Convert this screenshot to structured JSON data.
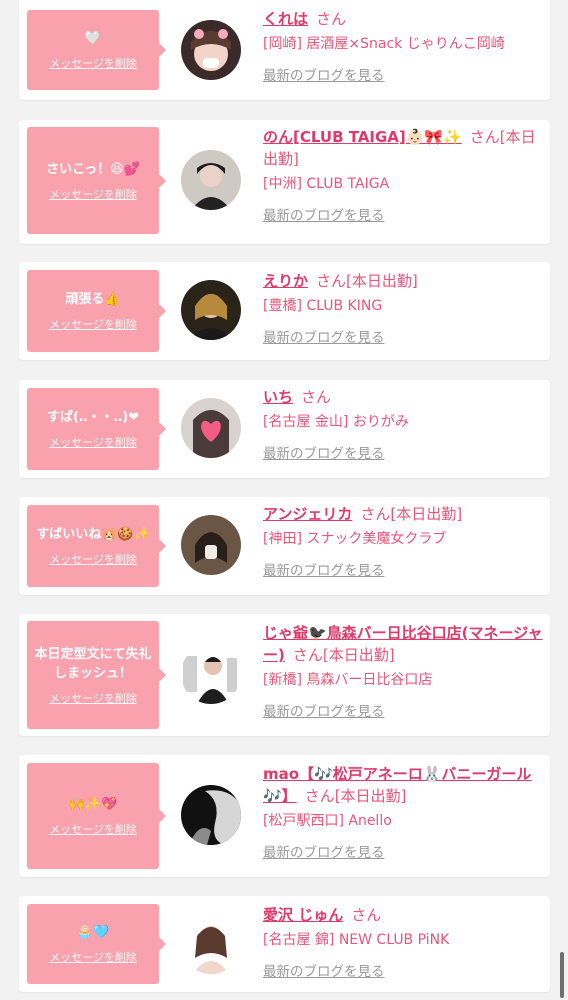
{
  "items": [
    {
      "message": "🤍",
      "delete_label": "メッセージを削除",
      "name": "くれは",
      "san": "さん",
      "shop": "[岡崎] 居酒屋×Snack じゃりんこ岡崎",
      "blog_label": "最新のブログを見る",
      "avatar": "avatar-photo-kureha"
    },
    {
      "message": "さいこっ！😆💕",
      "delete_label": "メッセージを削除",
      "name": "のん[CLUB TAIGA]👶🏻🎀✨",
      "san": "さん[本日出勤]",
      "shop": "[中洲] CLUB TAIGA",
      "blog_label": "最新のブログを見る",
      "avatar": "avatar-photo-non"
    },
    {
      "message": "頑張る👍",
      "delete_label": "メッセージを削除",
      "name": "えりか",
      "san": "さん[本日出勤]",
      "shop": "[豊橋] CLUB KING",
      "blog_label": "最新のブログを見る",
      "avatar": "avatar-photo-erika"
    },
    {
      "message": "すば(‥・・‥)❤",
      "delete_label": "メッセージを削除",
      "name": "いち",
      "san": "さん",
      "shop": "[名古屋 金山] おりがみ",
      "blog_label": "最新のブログを見る",
      "avatar": "avatar-photo-ichi"
    },
    {
      "message": "すばいいね🐹🍪✨",
      "delete_label": "メッセージを削除",
      "name": "アンジェリカ",
      "san": "さん[本日出勤]",
      "shop": "[神田] スナック美魔女クラブ",
      "blog_label": "最新のブログを見る",
      "avatar": "avatar-photo-angelica"
    },
    {
      "message": "本日定型文にて失礼しまッシュ！",
      "delete_label": "メッセージを削除",
      "name": "じゃ爺🐦‍⬛鳥森バー日比谷口店(マネージャー)",
      "san": "さん[本日出勤]",
      "shop": "[新橋] 鳥森バー日比谷口店",
      "blog_label": "最新のブログを見る",
      "avatar": "avatar-photo-jaji"
    },
    {
      "message": "🙌✨💖",
      "delete_label": "メッセージを削除",
      "name": "mao【🎶松戸アネーロ🐰バニーガール🎶】",
      "san": "さん[本日出勤]",
      "shop": "[松戸駅西口] Anello",
      "blog_label": "最新のブログを見る",
      "avatar": "avatar-photo-mao"
    },
    {
      "message": "🧁🩵",
      "delete_label": "メッセージを削除",
      "name": "愛沢 じゅん",
      "san": "さん",
      "shop": "[名古屋 錦] NEW CLUB PiNK",
      "blog_label": "最新のブログを見る",
      "avatar": "avatar-photo-jun"
    }
  ],
  "colors": {
    "bubble": "#f9a1ad",
    "name": "#e03a6a",
    "text": "#e8567a",
    "link": "#9a9a9a",
    "background": "#f2f2f2"
  }
}
